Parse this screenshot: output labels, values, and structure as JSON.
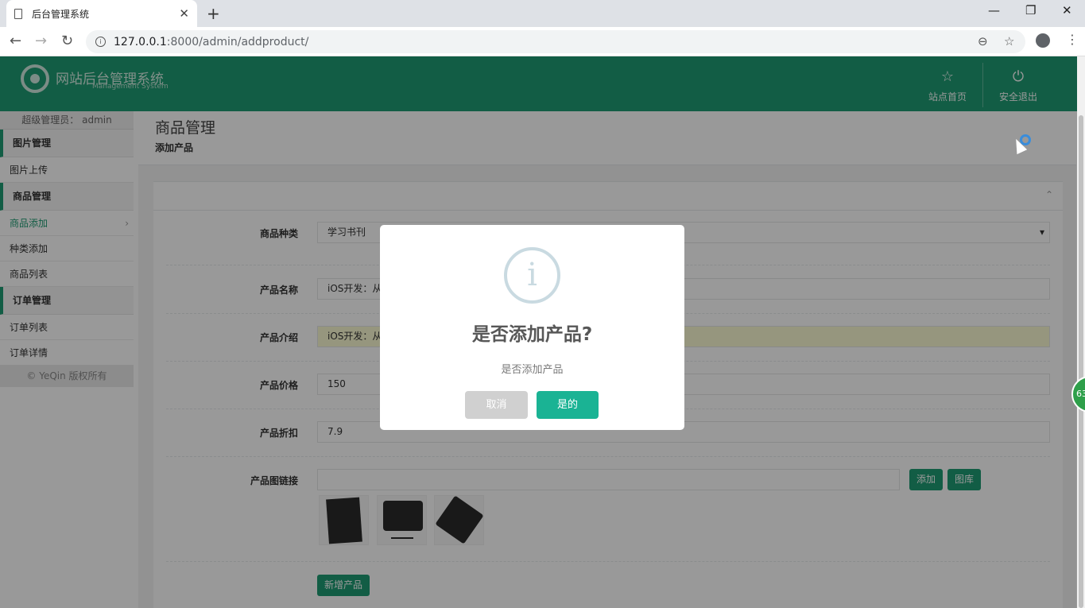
{
  "browser": {
    "tab_title": "后台管理系统",
    "tab_close": "✕",
    "new_tab": "+",
    "url_host": "127.0.0.1",
    "url_path": ":8000/admin/addproduct/",
    "win_min": "—",
    "win_restore": "❐",
    "win_close": "✕",
    "back": "←",
    "forward": "→",
    "reload": "↻",
    "zoom_icon": "⊖",
    "star_icon": "☆",
    "menu_icon": "⋮"
  },
  "header": {
    "logo_title": "网站后台管理系统",
    "logo_subtitle": "Management System",
    "nav": [
      {
        "icon": "☆",
        "label": "站点首页"
      },
      {
        "icon": "⏻",
        "label": "安全退出"
      }
    ]
  },
  "sidebar": {
    "admin_label": "超级管理员：  admin",
    "sections": [
      {
        "title": "图片管理",
        "items": [
          "图片上传"
        ]
      },
      {
        "title": "商品管理",
        "items": [
          "商品添加",
          "种类添加",
          "商品列表"
        ]
      },
      {
        "title": "订单管理",
        "items": [
          "订单列表",
          "订单详情"
        ]
      }
    ],
    "active_chevron": "›",
    "copyright": "© YeQin 版权所有"
  },
  "page": {
    "title": "商品管理",
    "subtitle": "添加产品",
    "collapse_icon": "⌃"
  },
  "form": {
    "category_label": "商品种类",
    "category_value": "学习书刊",
    "select_caret": "▾",
    "name_label": "产品名称",
    "name_value": "iOS开发：从",
    "intro_label": "产品介绍",
    "intro_value": "iOS开发：从",
    "price_label": "产品价格",
    "price_value": "150",
    "discount_label": "产品折扣",
    "discount_value": "7.9",
    "image_link_label": "产品图链接",
    "image_link_value": "",
    "add_button": "添加",
    "gallery_button": "图库",
    "submit_button": "新增产品"
  },
  "modal": {
    "icon": "i",
    "title": "是否添加产品?",
    "text": "是否添加产品",
    "cancel": "取消",
    "confirm": "是的"
  },
  "float_ball": "63",
  "colors": {
    "brand": "#1e9c73",
    "confirm": "#1ab394",
    "cancel": "#d0d0d0"
  }
}
